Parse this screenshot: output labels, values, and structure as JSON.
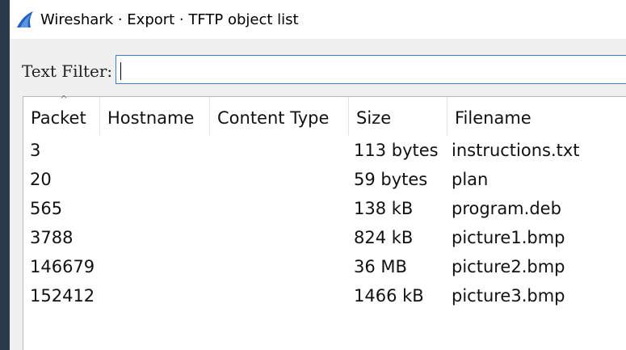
{
  "window": {
    "title": "Wireshark · Export · TFTP object list",
    "icon": "wireshark-fin-icon",
    "accent": "#1f5fbf"
  },
  "filter": {
    "label": "Text Filter:",
    "value": ""
  },
  "table": {
    "columns": [
      "Packet",
      "Hostname",
      "Content Type",
      "Size",
      "Filename"
    ],
    "sort_column": "Packet",
    "rows": [
      {
        "packet": "3",
        "hostname": "",
        "content_type": "",
        "size": "113 bytes",
        "filename": "instructions.txt"
      },
      {
        "packet": "20",
        "hostname": "",
        "content_type": "",
        "size": "59 bytes",
        "filename": "plan"
      },
      {
        "packet": "565",
        "hostname": "",
        "content_type": "",
        "size": "138 kB",
        "filename": "program.deb"
      },
      {
        "packet": "3788",
        "hostname": "",
        "content_type": "",
        "size": "824 kB",
        "filename": "picture1.bmp"
      },
      {
        "packet": "146679",
        "hostname": "",
        "content_type": "",
        "size": "36 MB",
        "filename": "picture2.bmp"
      },
      {
        "packet": "152412",
        "hostname": "",
        "content_type": "",
        "size": "1466 kB",
        "filename": "picture3.bmp"
      }
    ]
  }
}
